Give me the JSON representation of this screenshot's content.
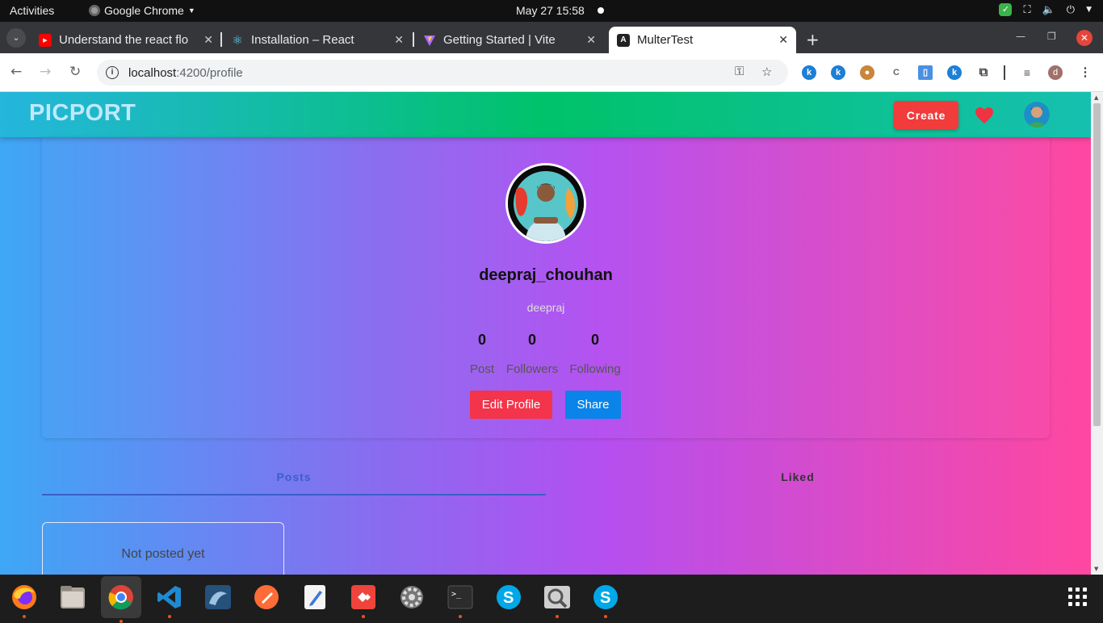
{
  "system": {
    "activities": "Activities",
    "app_name": "Google Chrome",
    "clock": "May 27  15:58"
  },
  "tabs": [
    {
      "title": "Understand the react flo",
      "favicon": "youtube-icon",
      "active": false
    },
    {
      "title": "Installation – React",
      "favicon": "react-icon",
      "active": false
    },
    {
      "title": "Getting Started | Vite",
      "favicon": "vite-icon",
      "active": false
    },
    {
      "title": "MulterTest",
      "favicon": "angular-icon",
      "active": true
    }
  ],
  "address": {
    "host": "localhost",
    "path": ":4200/profile"
  },
  "app": {
    "logo": "PICPORT",
    "create_label": "Create"
  },
  "profile": {
    "username": "deepraj_chouhan",
    "handle": "deepraj",
    "stats": [
      {
        "value": "0",
        "label": "Post"
      },
      {
        "value": "0",
        "label": "Followers"
      },
      {
        "value": "0",
        "label": "Following"
      }
    ],
    "edit_label": "Edit Profile",
    "share_label": "Share"
  },
  "profile_tabs": {
    "posts": "Posts",
    "liked": "Liked"
  },
  "empty_state": "Not posted yet",
  "colors": {
    "create_button": "#f23b3b",
    "edit_button": "#f3344b",
    "share_button": "#0a84e8",
    "active_tab": "#3a5fc8"
  },
  "dock": [
    "firefox-icon",
    "files-icon",
    "chrome-icon",
    "vscode-icon",
    "mysql-workbench-icon",
    "postman-icon",
    "text-editor-icon",
    "anydesk-icon",
    "settings-icon",
    "terminal-icon",
    "skype-icon",
    "image-viewer-icon",
    "skype-icon",
    "app-grid-icon"
  ]
}
